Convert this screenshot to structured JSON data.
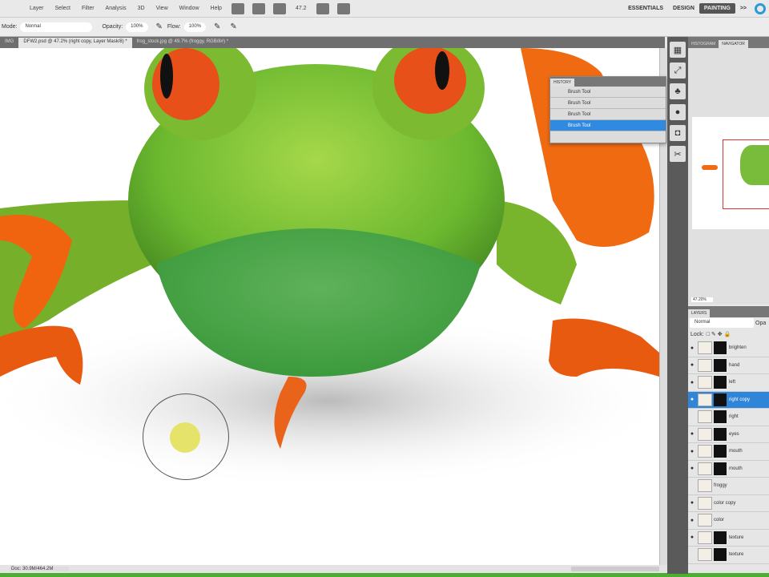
{
  "menu": [
    "Layer",
    "Select",
    "Filter",
    "Analysis",
    "3D",
    "View",
    "Window",
    "Help"
  ],
  "zoom_level": "47.2",
  "workspaces": [
    "ESSENTIALS",
    "DESIGN",
    "PAINTING"
  ],
  "workspace_more": ">>",
  "options": {
    "mode_label": "Mode:",
    "mode_value": "Normal",
    "opacity_label": "Opacity:",
    "opacity_value": "100%",
    "flow_label": "Flow:",
    "flow_value": "100%"
  },
  "doc_tabs": [
    "IMG",
    "DFW2.psd @ 47.2% (right copy, Layer Mask/8) *",
    "frog_stock.jpg @ 49.7% (froggy, RGB/8#) *"
  ],
  "status": {
    "doc": "Doc: 30.9M/464.2M"
  },
  "nav": {
    "tabs": [
      "HISTOGRAM",
      "NAVIGATOR"
    ],
    "zoom": "47.20%"
  },
  "history": {
    "title": "HISTORY",
    "items": [
      "Brush Tool",
      "Brush Tool",
      "Brush Tool",
      "Brush Tool"
    ]
  },
  "layers": {
    "tab": "LAYERS",
    "blend": "Normal",
    "opacity_label": "Opa",
    "lock_label": "Lock:",
    "items": [
      {
        "name": "brighten",
        "visible": true,
        "selected": false
      },
      {
        "name": "hand",
        "visible": true,
        "selected": false
      },
      {
        "name": "left",
        "visible": true,
        "selected": false
      },
      {
        "name": "right copy",
        "visible": true,
        "selected": true
      },
      {
        "name": "right",
        "visible": false,
        "selected": false
      },
      {
        "name": "eyes",
        "visible": true,
        "selected": false
      },
      {
        "name": "mouth",
        "visible": true,
        "selected": false
      },
      {
        "name": "mouth",
        "visible": true,
        "selected": false
      },
      {
        "name": "froggy",
        "visible": false,
        "selected": false
      },
      {
        "name": "color copy",
        "visible": true,
        "selected": false
      },
      {
        "name": "color",
        "visible": true,
        "selected": false
      },
      {
        "name": "texture",
        "visible": true,
        "selected": false
      },
      {
        "name": "texture",
        "visible": false,
        "selected": false
      }
    ]
  }
}
